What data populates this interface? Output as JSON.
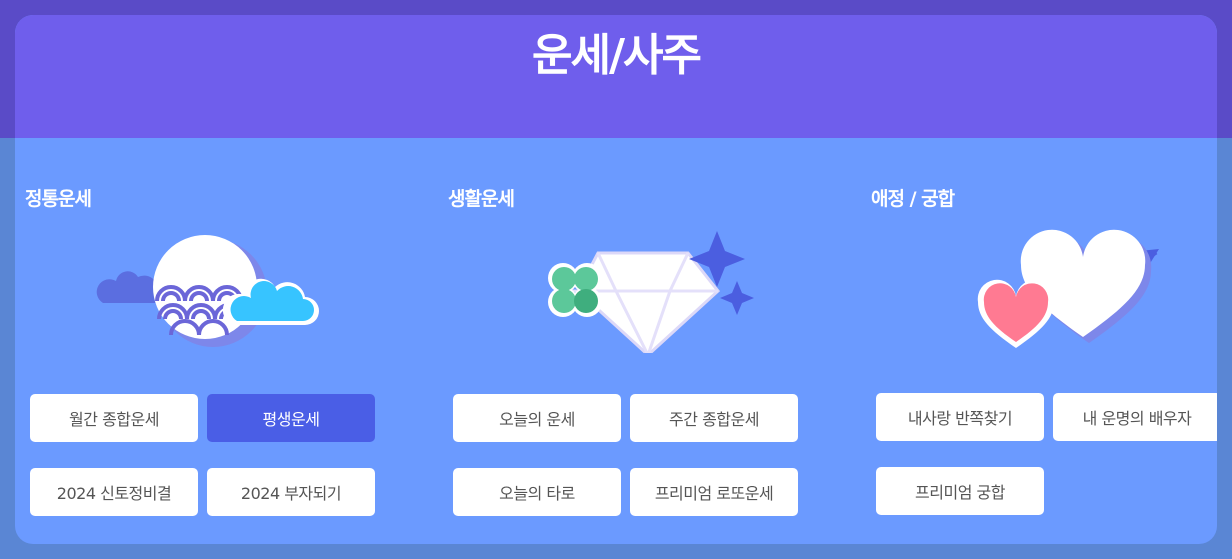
{
  "title": "운세/사주",
  "sections": [
    {
      "title": "정통운세",
      "buttons": [
        "월간 종합운세",
        "평생운세",
        "2024 신토정비결",
        "2024 부자되기"
      ]
    },
    {
      "title": "생활운세",
      "buttons": [
        "오늘의 운세",
        "주간 종합운세",
        "오늘의 타로",
        "프리미엄 로또운세"
      ]
    },
    {
      "title": "애정 / 궁합",
      "buttons": [
        "내사랑 반쪽찾기",
        "내 운명의 배우자",
        "프리미엄 궁합"
      ]
    }
  ],
  "active_button": "평생운세",
  "colors": {
    "panel": "#6b9aff",
    "header": "#6f5eec",
    "active": "#4a5ee6"
  },
  "icons": [
    "moon-cloud-waves-illustration",
    "clover-diamond-illustration",
    "hearts-arrow-illustration"
  ]
}
